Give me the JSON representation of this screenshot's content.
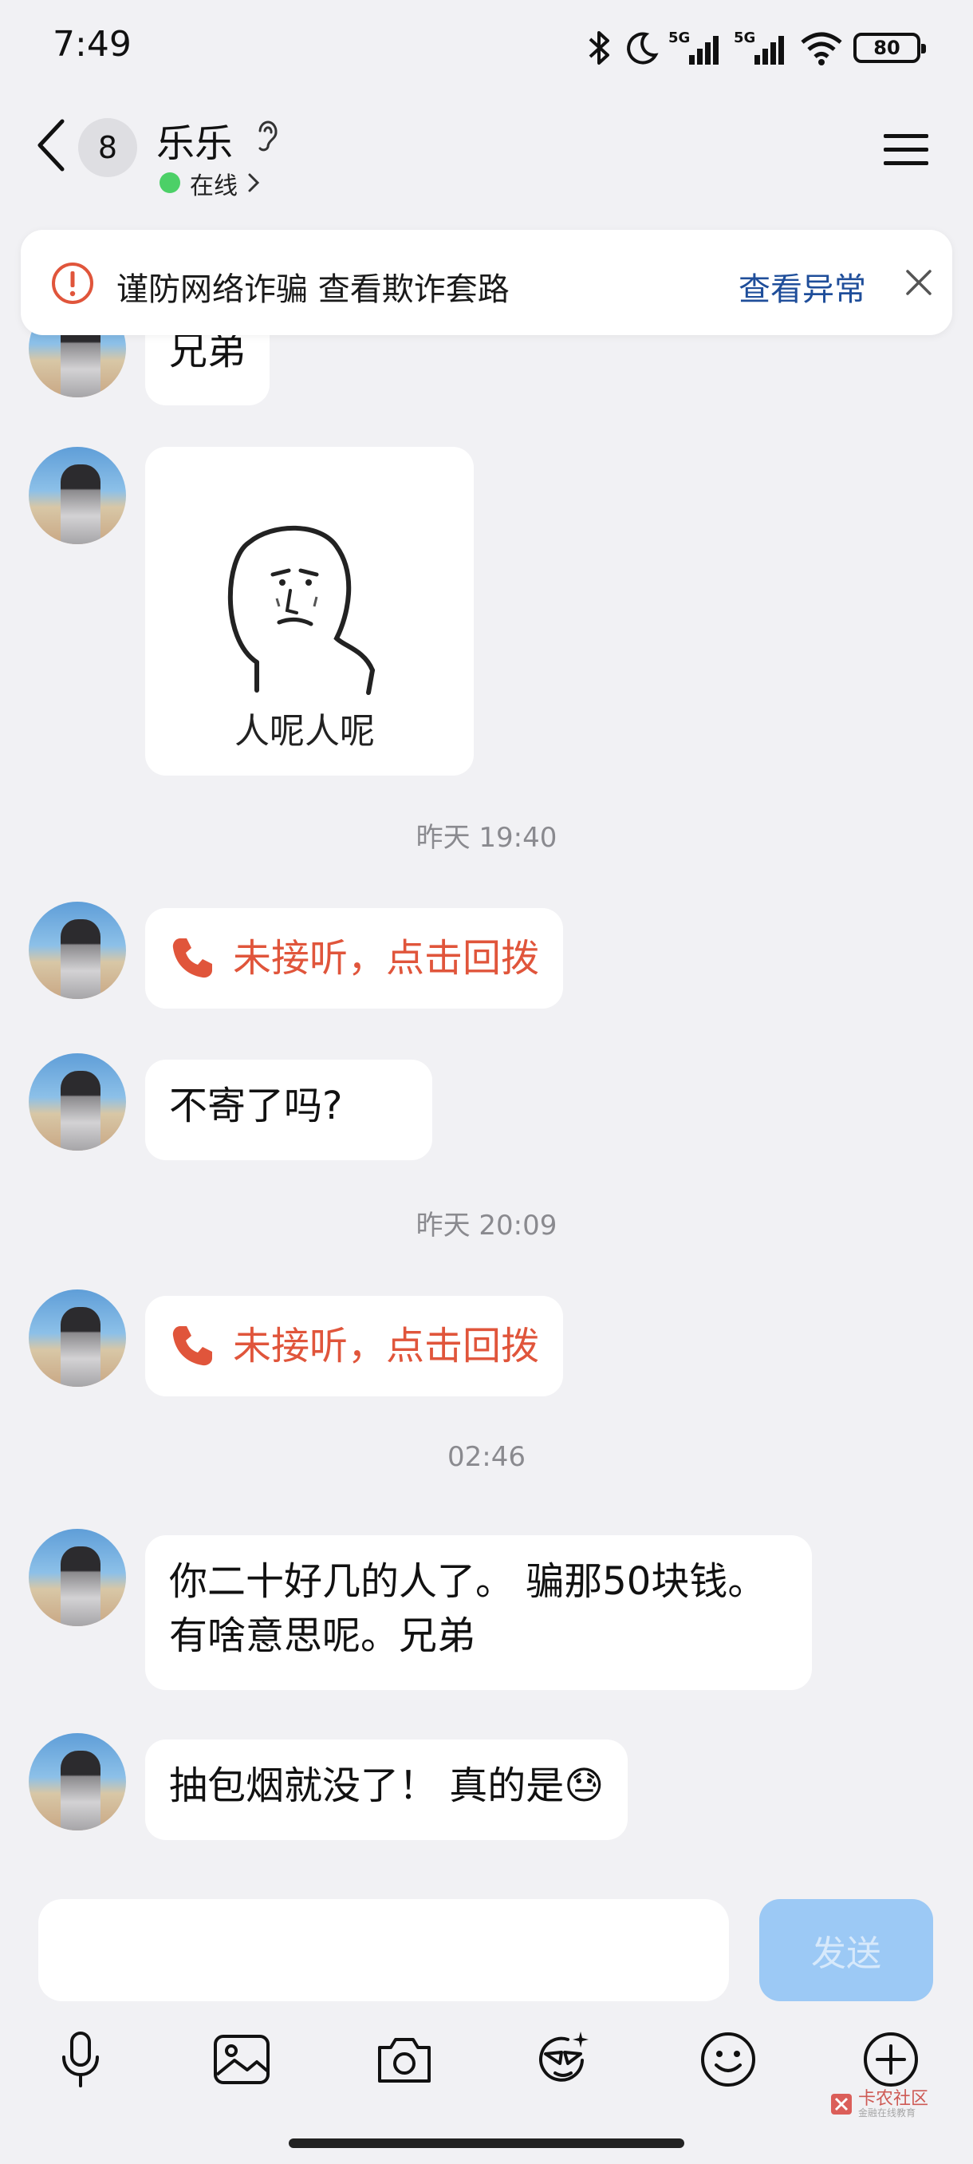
{
  "status_bar": {
    "time": "7:49",
    "battery": "80",
    "icons": [
      "bluetooth-icon",
      "moon-icon",
      "5g-signal-icon",
      "5g-signal-icon",
      "wifi-icon",
      "battery-icon"
    ]
  },
  "header": {
    "unread_count": "8",
    "contact_name": "乐乐",
    "online_status": "在线"
  },
  "fraud_banner": {
    "text": "谨防网络诈骗 查看欺诈套路",
    "link": "查看异常"
  },
  "messages": {
    "m1": "兄弟",
    "sticker_caption": "人呢人呢",
    "ts1": "昨天 19:40",
    "call1": "未接听，点击回拨",
    "m2": "不寄了吗?",
    "ts2": "昨天 20:09",
    "call2": "未接听，点击回拨",
    "ts3": "02:46",
    "m3": "你二十好几的人了。 骗那50块钱。有啥意思呢。兄弟",
    "m4": "抽包烟就没了！  真的是😓"
  },
  "input": {
    "placeholder": "",
    "send_label": "发送"
  },
  "toolbar": [
    "microphone-icon",
    "image-icon",
    "camera-icon",
    "sticker-icon",
    "emoji-icon",
    "plus-icon"
  ],
  "watermark": {
    "line1": "卡农社区",
    "line2": "金融在线教育"
  },
  "colors": {
    "background": "#f1f1f4",
    "missed_call": "#e0553b",
    "link_blue": "#1f4e9a",
    "send_button": "#9cc9f5",
    "online_green": "#4cd067"
  }
}
